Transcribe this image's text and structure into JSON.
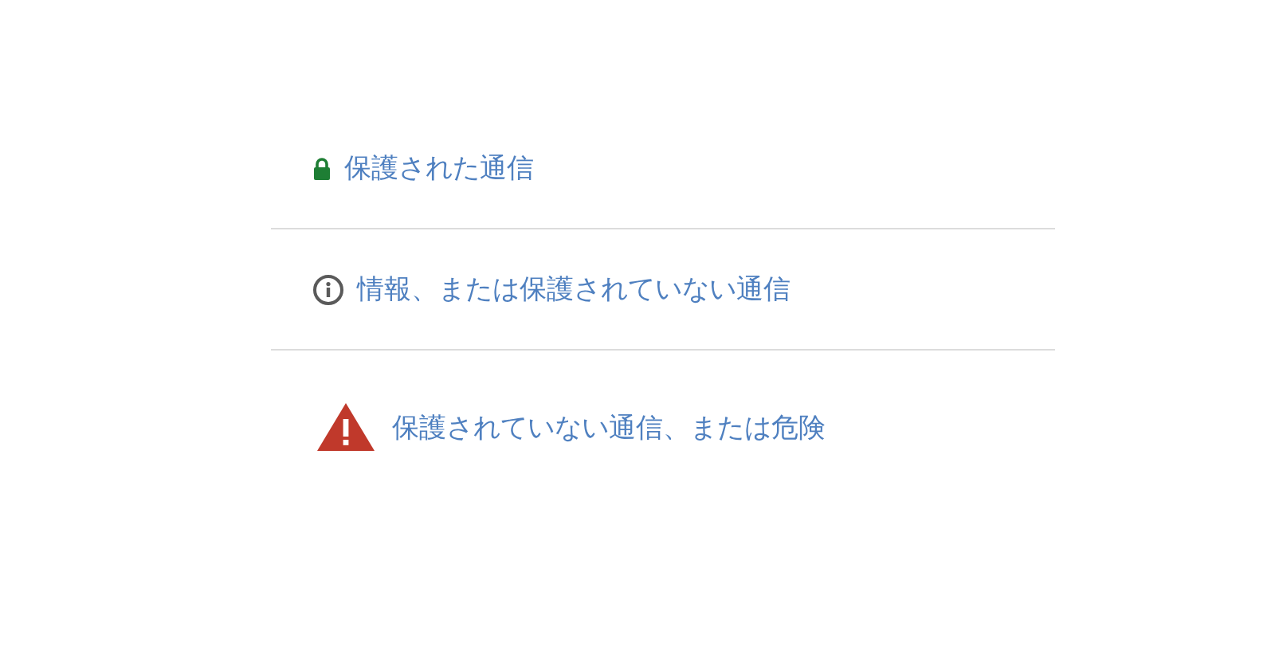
{
  "items": [
    {
      "kind": "secure",
      "label": "保護された通信"
    },
    {
      "kind": "info",
      "label": "情報、または保護されていない通信"
    },
    {
      "kind": "dangerous",
      "label": "保護されていない通信、または危険"
    }
  ]
}
